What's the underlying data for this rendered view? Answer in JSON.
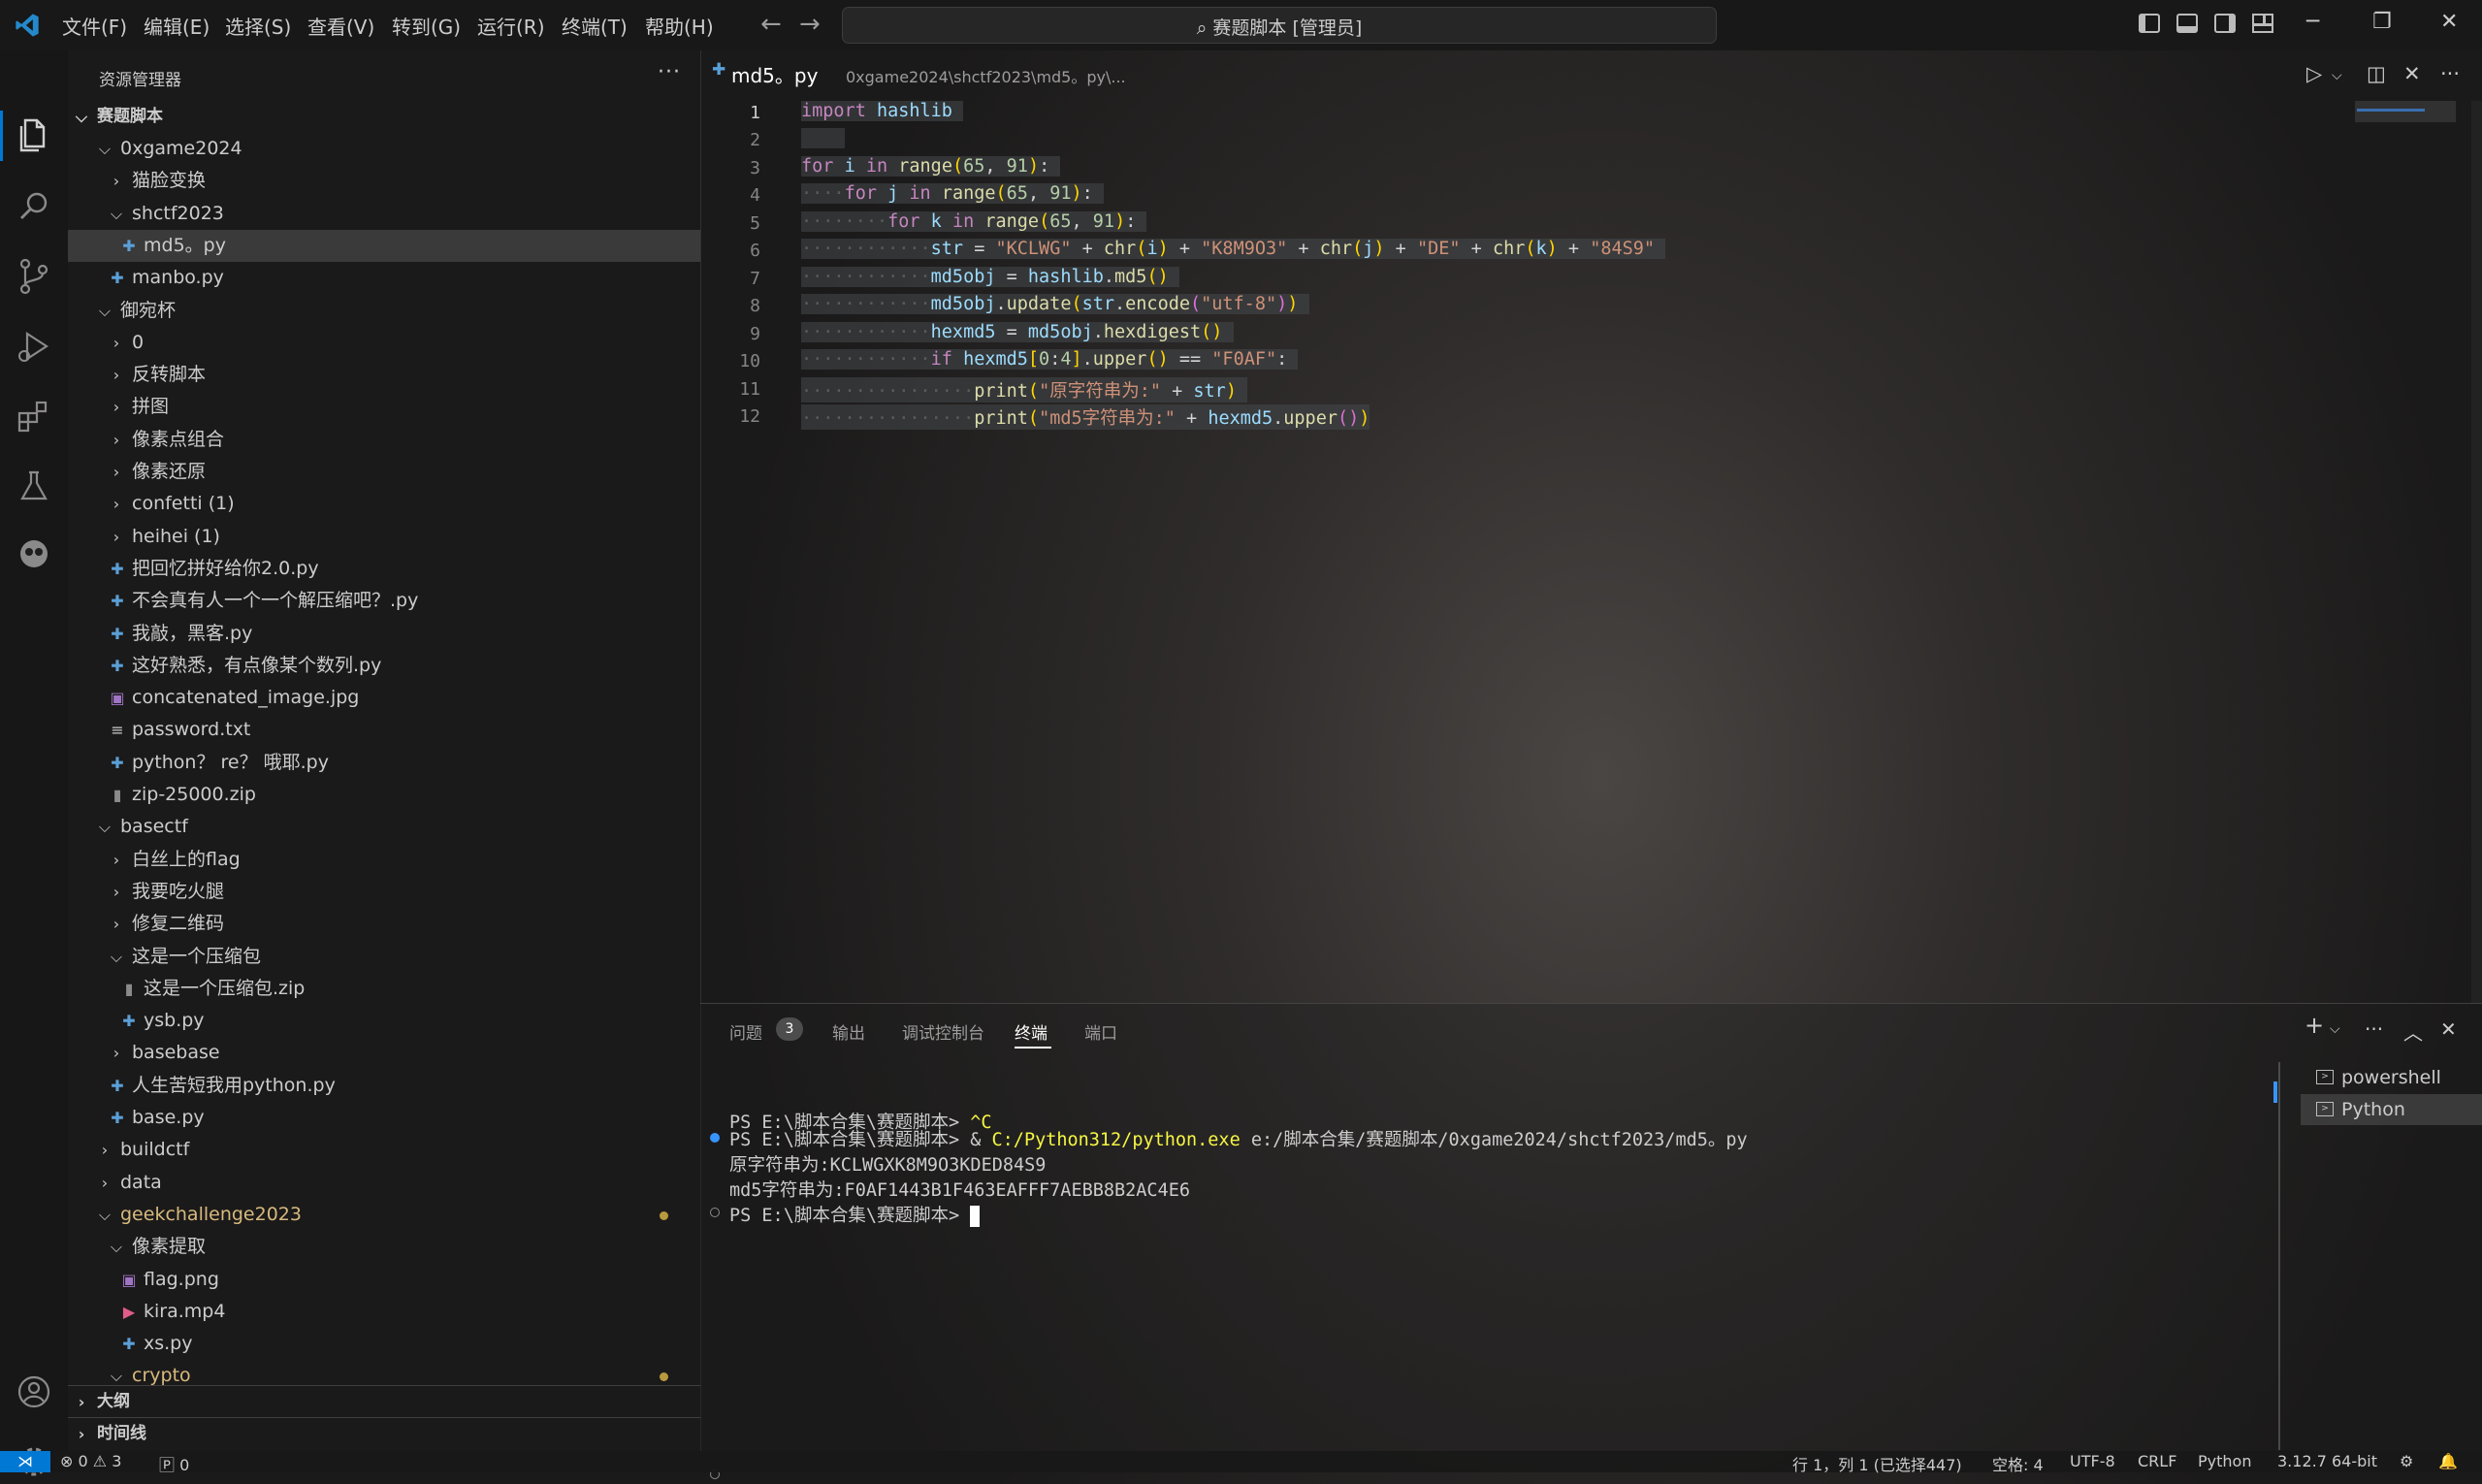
{
  "menu": [
    "文件(F)",
    "编辑(E)",
    "选择(S)",
    "查看(V)",
    "转到(G)",
    "运行(R)",
    "终端(T)",
    "帮助(H)"
  ],
  "title": "赛题脚本 [管理员]",
  "sidebar": {
    "title": "资源管理器",
    "root": "赛题脚本",
    "tree": [
      {
        "label": "0xgame2024",
        "type": "folder-open",
        "depth": 1
      },
      {
        "label": "猫脸变换",
        "type": "folder",
        "depth": 2
      },
      {
        "label": "shctf2023",
        "type": "folder-open",
        "depth": 2
      },
      {
        "label": "md5。py",
        "type": "py",
        "depth": 3,
        "selected": true
      },
      {
        "label": "manbo.py",
        "type": "py",
        "depth": 2
      },
      {
        "label": "御宛杯",
        "type": "folder-open",
        "depth": 1
      },
      {
        "label": "0",
        "type": "folder",
        "depth": 2
      },
      {
        "label": "反转脚本",
        "type": "folder",
        "depth": 2
      },
      {
        "label": "拼图",
        "type": "folder",
        "depth": 2
      },
      {
        "label": "像素点组合",
        "type": "folder",
        "depth": 2
      },
      {
        "label": "像素还原",
        "type": "folder",
        "depth": 2
      },
      {
        "label": "confetti (1)",
        "type": "folder",
        "depth": 2
      },
      {
        "label": "heihei (1)",
        "type": "folder",
        "depth": 2
      },
      {
        "label": "把回忆拼好给你2.0.py",
        "type": "py",
        "depth": 2
      },
      {
        "label": "不会真有人一个一个解压缩吧？.py",
        "type": "py",
        "depth": 2
      },
      {
        "label": "我敲，黑客.py",
        "type": "py",
        "depth": 2
      },
      {
        "label": "这好熟悉，有点像某个数列.py",
        "type": "py",
        "depth": 2
      },
      {
        "label": "concatenated_image.jpg",
        "type": "img",
        "depth": 2
      },
      {
        "label": "password.txt",
        "type": "txt",
        "depth": 2
      },
      {
        "label": "python？ re？ 哦耶.py",
        "type": "py",
        "depth": 2
      },
      {
        "label": "zip-25000.zip",
        "type": "zip",
        "depth": 2
      },
      {
        "label": "basectf",
        "type": "folder-open",
        "depth": 1
      },
      {
        "label": "白丝上的flag",
        "type": "folder",
        "depth": 2
      },
      {
        "label": "我要吃火腿",
        "type": "folder",
        "depth": 2
      },
      {
        "label": "修复二维码",
        "type": "folder",
        "depth": 2
      },
      {
        "label": "这是一个压缩包",
        "type": "folder-open",
        "depth": 2
      },
      {
        "label": "这是一个压缩包.zip",
        "type": "zip",
        "depth": 3
      },
      {
        "label": "ysb.py",
        "type": "py",
        "depth": 3
      },
      {
        "label": "basebase",
        "type": "folder",
        "depth": 2
      },
      {
        "label": "人生苦短我用python.py",
        "type": "py",
        "depth": 2
      },
      {
        "label": "base.py",
        "type": "py",
        "depth": 2
      },
      {
        "label": "buildctf",
        "type": "folder",
        "depth": 1
      },
      {
        "label": "data",
        "type": "folder",
        "depth": 1
      },
      {
        "label": "geekchallenge2023",
        "type": "folder-open",
        "depth": 1,
        "modified": true
      },
      {
        "label": "像素提取",
        "type": "folder-open",
        "depth": 2
      },
      {
        "label": "flag.png",
        "type": "img",
        "depth": 3
      },
      {
        "label": "kira.mp4",
        "type": "mp4",
        "depth": 3
      },
      {
        "label": "xs.py",
        "type": "py",
        "depth": 3
      },
      {
        "label": "crypto",
        "type": "folder-open",
        "depth": 2,
        "modified": true
      }
    ],
    "outline": "大纲",
    "timeline": "时间线"
  },
  "editor": {
    "tab_label": "md5。py",
    "tab_path": "0xgame2024\\shctf2023\\md5。py\\...",
    "line_numbers": [
      "1",
      "2",
      "3",
      "4",
      "5",
      "6",
      "7",
      "8",
      "9",
      "10",
      "11",
      "12"
    ]
  },
  "panel": {
    "tabs": [
      "问题",
      "输出",
      "调试控制台",
      "终端",
      "端口"
    ],
    "problems_count": "3",
    "terminal_lines": [
      "PS E:\\脚本合集\\赛题脚本> ",
      "PS E:\\脚本合集\\赛题脚本> & ",
      "原字符串为:KCLWGXK8M9O3KDED84S9",
      "md5字符串为:F0AF1443B1F463EAFFF7AEBB8B2AC4E6",
      "PS E:\\脚本合集\\赛题脚本> "
    ],
    "ctrl_c": "^C",
    "cmd_exe": "C:/Python312/python.exe",
    "cmd_arg": " e:/脚本合集/赛题脚本/0xgame2024/shctf2023/md5。py",
    "terminals": [
      "powershell",
      "Python"
    ]
  },
  "status": {
    "problems": "⊗ 0 ⚠ 3",
    "ports": "🄿 0",
    "position": "行 1，列 1 (已选择447)",
    "indent": "空格: 4",
    "encoding": "UTF-8",
    "eol": "CRLF",
    "language": "Python",
    "interpreter": "3.12.7 64-bit"
  },
  "colors": {
    "accent": "#0078d4",
    "keyword": "#c586c0",
    "string": "#ce9178",
    "function": "#dcdcaa"
  }
}
